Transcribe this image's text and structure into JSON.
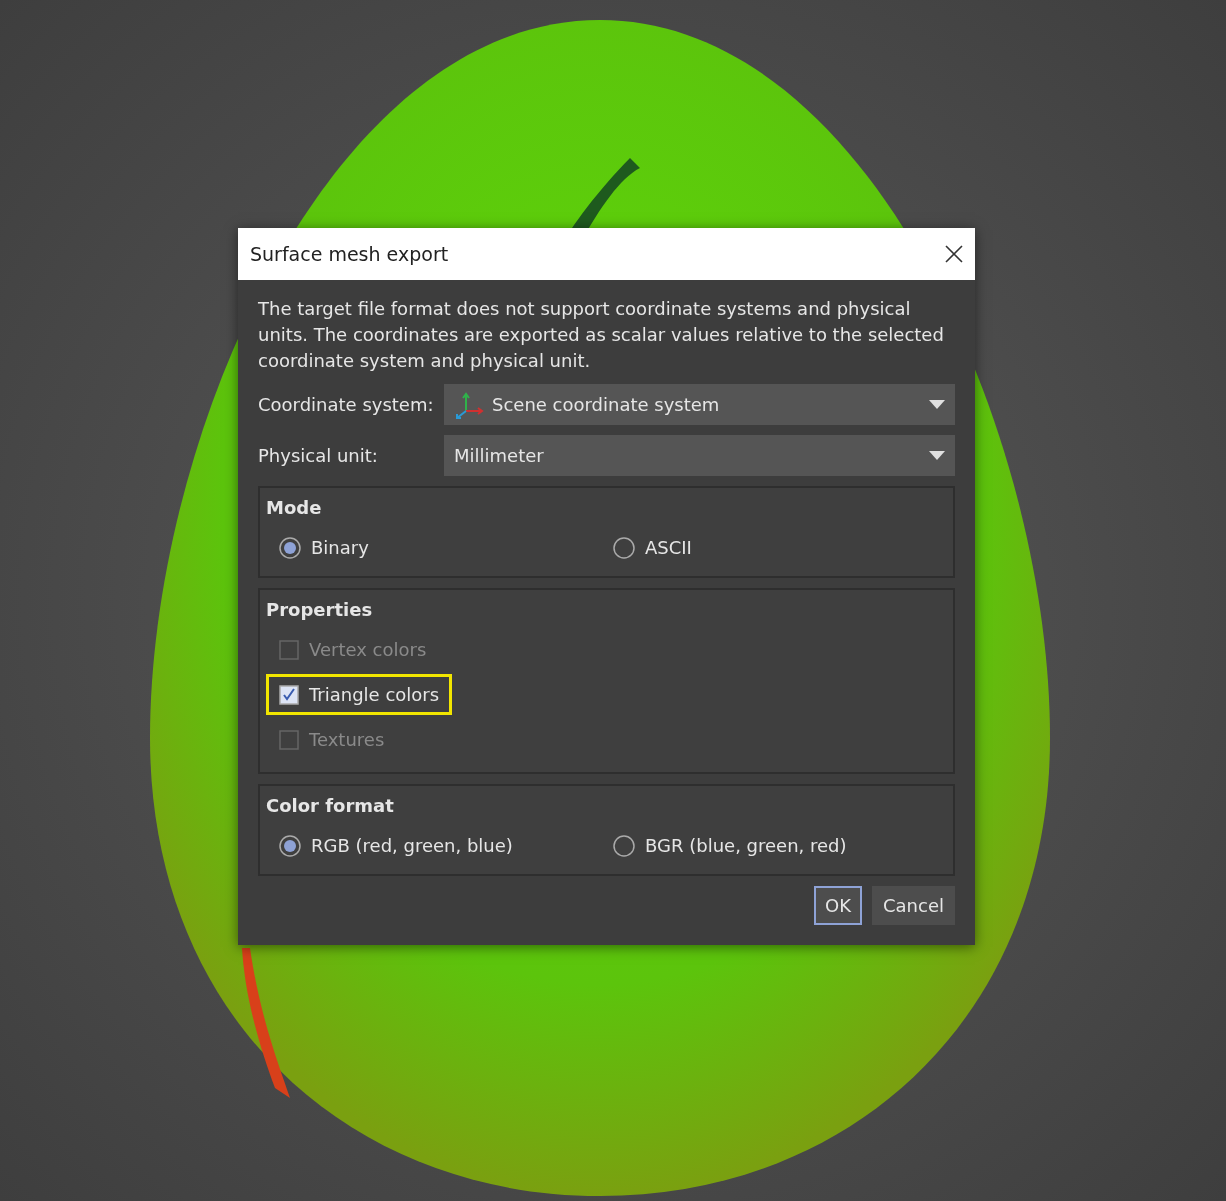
{
  "dialog": {
    "title": "Surface mesh export",
    "message": "The target file format does not support coordinate systems and physical units. The coordinates are exported as scalar values relative to the selected coordinate system and physical unit.",
    "fields": [
      {
        "label": "Coordinate system:",
        "value": "Scene coordinate system",
        "kind": "axes"
      },
      {
        "label": "Physical unit:",
        "value": "Millimeter",
        "kind": "plain"
      }
    ],
    "groups": [
      {
        "title": "Mode",
        "kind": "radio",
        "options": [
          {
            "label": "Binary",
            "selected": true
          },
          {
            "label": "ASCII",
            "selected": false
          }
        ]
      },
      {
        "title": "Properties",
        "kind": "checkbox",
        "options": [
          {
            "label": "Vertex colors",
            "checked": false,
            "disabled": true,
            "highlighted": false
          },
          {
            "label": "Triangle colors",
            "checked": true,
            "disabled": false,
            "highlighted": true
          },
          {
            "label": "Textures",
            "checked": false,
            "disabled": true,
            "highlighted": false
          }
        ]
      },
      {
        "title": "Color format",
        "kind": "radio",
        "options": [
          {
            "label": "RGB (red, green, blue)",
            "selected": true
          },
          {
            "label": "BGR (blue, green, red)",
            "selected": false
          }
        ]
      }
    ],
    "buttons": [
      {
        "label": "OK",
        "default": true
      },
      {
        "label": "Cancel",
        "default": false
      }
    ]
  }
}
